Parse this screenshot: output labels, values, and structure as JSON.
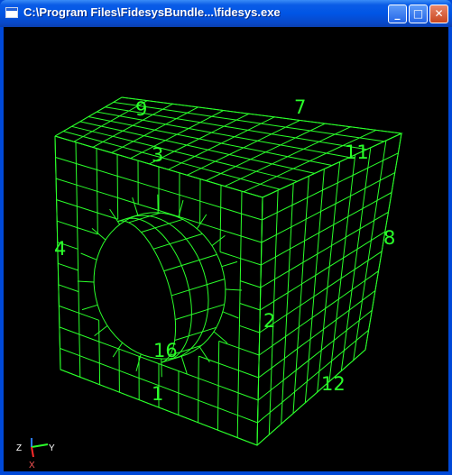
{
  "window": {
    "title": "C:\\Program Files\\FidesysBundle...\\fidesys.exe",
    "buttons": {
      "minimize": "_",
      "maximize": "□",
      "close": "✕"
    }
  },
  "colors": {
    "mesh": "#2aff2a",
    "background": "#000000",
    "titlebar": "#0055e5"
  },
  "mesh": {
    "labels": {
      "top_back_left": "9",
      "top_back_right": "7",
      "top_front": "3",
      "top_right": "11",
      "left": "4",
      "right_back": "8",
      "front_right": "2",
      "hole": "16",
      "front_bottom": "1",
      "right_bottom": "12"
    }
  },
  "axis_triad": {
    "z": "Z",
    "y": "Y",
    "x": "X"
  }
}
